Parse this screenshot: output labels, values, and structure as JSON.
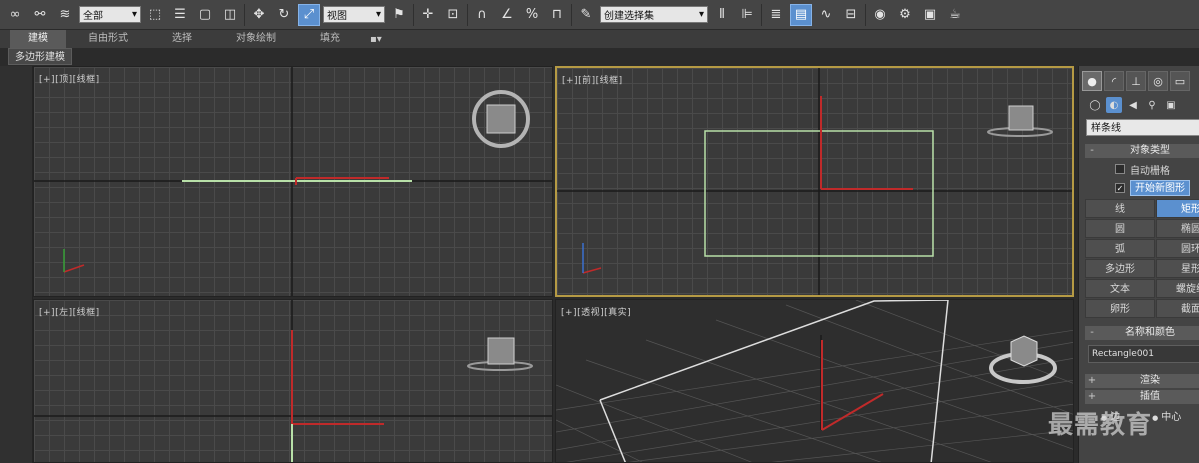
{
  "toolbar": {
    "selection_filter": "全部",
    "coord_system": "视图",
    "named_selection": "创建选择集"
  },
  "ribbon": {
    "tabs": [
      "建模",
      "自由形式",
      "选择",
      "对象绘制",
      "填充"
    ],
    "sub_label": "多边形建模"
  },
  "viewports": {
    "top": "[+][顶][线框]",
    "front": "[+][前][线框]",
    "left": "[+][左][线框]",
    "perspective": "[+][透视][真实]"
  },
  "command_panel": {
    "category": "样条线",
    "object_type_title": "对象类型",
    "autogrid_label": "自动栅格",
    "start_new_shape": "开始新图形",
    "shapes": [
      "线",
      "矩形",
      "圆",
      "椭圆",
      "弧",
      "圆环",
      "多边形",
      "星形",
      "文本",
      "螺旋线",
      "卵形",
      "截面"
    ],
    "name_color_title": "名称和颜色",
    "object_name": "Rectangle001",
    "render_title": "渲染",
    "interpolation_title": "插值",
    "creation_method": [
      "边",
      "中心"
    ]
  },
  "watermark": "最需教育",
  "colors": {
    "accent": "#5b90cf",
    "active_viewport": "#b59a44",
    "axis_red": "#c02a2a",
    "rect_green": "#b8e0a8"
  }
}
